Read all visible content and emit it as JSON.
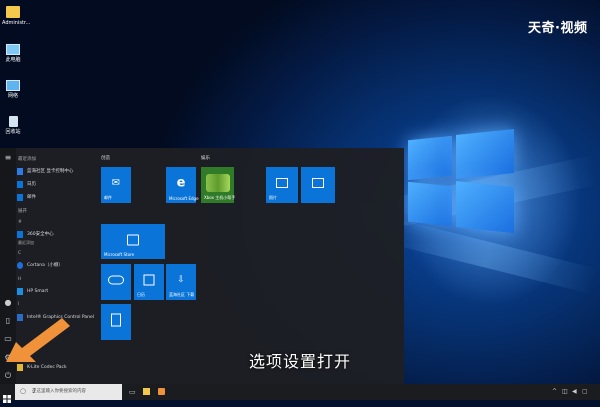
{
  "desktop": {
    "icons": [
      {
        "label": "Administr...",
        "icon": "folder-icon"
      },
      {
        "label": "此电脑",
        "icon": "computer-icon"
      },
      {
        "label": "网络",
        "icon": "network-icon"
      },
      {
        "label": "回收站",
        "icon": "recycle-bin-icon"
      }
    ],
    "watermark": "天奇·视频"
  },
  "start_menu": {
    "recent_header": "最近添加",
    "recent_apps": [
      "蓝海社区 显卡控制中心",
      "日历",
      "邮件"
    ],
    "expand_label": "展开",
    "sections": [
      {
        "letter": "#",
        "apps": [
          "360安全中心"
        ]
      },
      {
        "letter": "C",
        "apps": [
          "Cortana（小娜）"
        ]
      },
      {
        "letter": "H",
        "apps": [
          "HP Smart"
        ]
      },
      {
        "letter": "I",
        "apps": [
          "Intel® Graphics Control Panel"
        ]
      },
      {
        "letter": "K",
        "apps": [
          "K-Lite Codec Pack"
        ]
      }
    ],
    "recent_sub": "最近添加",
    "tile_groups": [
      {
        "title": "创造"
      },
      {
        "title": "娱乐"
      }
    ],
    "tiles": {
      "mail": "邮件",
      "edge": "Microsoft Edge",
      "xbox": "Xbox 主机小帮手",
      "photos": "照片",
      "gallery": "",
      "store": "Microsoft Store",
      "weather": "",
      "calendar": "日历",
      "download": "蓝海社区 下载",
      "calculator": ""
    }
  },
  "caption": "选项设置打开",
  "taskbar": {
    "search_placeholder": "在这里输入你要搜索的内容"
  },
  "colors": {
    "tile_blue": "#0a74d8",
    "arrow_orange": "#f0923a",
    "start_bg": "#1d1f24"
  }
}
